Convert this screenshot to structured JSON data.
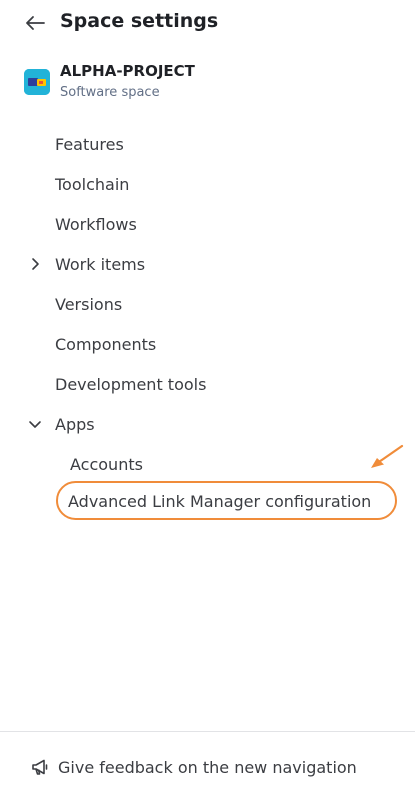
{
  "header": {
    "back_icon": "arrow-left-icon",
    "title": "Space settings"
  },
  "project": {
    "name": "ALPHA-PROJECT",
    "type": "Software space",
    "avatar_color": "#22b3d8"
  },
  "nav": {
    "features": "Features",
    "toolchain": "Toolchain",
    "workflows": "Workflows",
    "work_items": "Work items",
    "versions": "Versions",
    "components": "Components",
    "development_tools": "Development tools",
    "apps": "Apps",
    "apps_children": {
      "accounts": "Accounts",
      "advanced_link_manager": "Advanced Link Manager configuration"
    }
  },
  "annotation": {
    "color": "#f08c3a"
  },
  "footer": {
    "feedback_icon": "megaphone-icon",
    "feedback_label": "Give feedback on the new navigation"
  }
}
